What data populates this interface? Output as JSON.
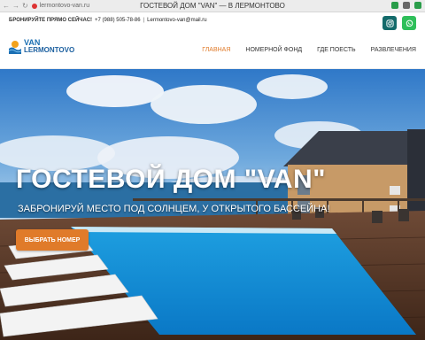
{
  "browser": {
    "url": "lermontovo-van.ru",
    "tab_title": "ГОСТЕВОЙ ДОМ \"VAN\" — В ЛЕРМОНТОВО"
  },
  "topbar": {
    "book_now": "БРОНИРУЙТЕ ПРЯМО СЕЙЧАС!",
    "phone": "+7 (988) 505-78-86",
    "separator": "|",
    "email": "Lermontovo-van@mail.ru"
  },
  "social": {
    "instagram_icon": "instagram-icon",
    "whatsapp_icon": "whatsapp-icon"
  },
  "logo": {
    "line1": "VAN",
    "line2": "LERMONTOVO"
  },
  "menu": {
    "items": [
      "ГЛАВНАЯ",
      "НОМЕРНОЙ ФОНД",
      "ГДЕ ПОЕСТЬ",
      "РАЗВЛЕЧЕНИЯ"
    ]
  },
  "hero": {
    "title": "ГОСТЕВОЙ ДОМ \"VAN\"",
    "subtitle": "ЗАБРОНИРУЙ МЕСТО ПОД СОЛНЦЕМ, У ОТКРЫТОГО БАССЕЙНА!",
    "cta": "ВЫБРАТЬ НОМЕР"
  },
  "colors": {
    "accent": "#e07b2a",
    "brand_blue": "#1b6fb3",
    "instagram_bg": "#146b6b",
    "whatsapp_bg": "#2fbf5a"
  }
}
